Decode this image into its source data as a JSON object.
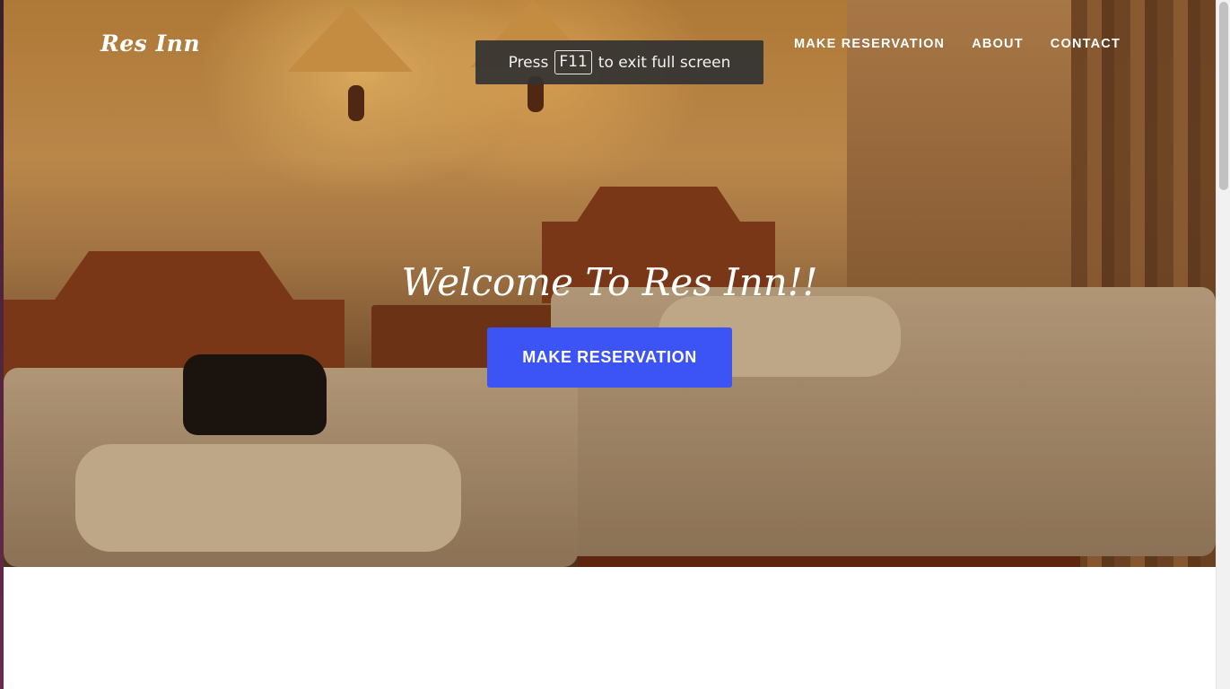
{
  "brand": {
    "name": "Res Inn"
  },
  "nav": {
    "items": [
      {
        "label": "MAKE RESERVATION"
      },
      {
        "label": "ABOUT"
      },
      {
        "label": "CONTACT"
      }
    ]
  },
  "hero": {
    "title": "Welcome To Res Inn!!",
    "cta_label": "MAKE RESERVATION",
    "cta_color": "#3c54f5"
  },
  "fullscreen_notice": {
    "prefix": "Press",
    "key": "F11",
    "suffix": "to exit full screen"
  }
}
